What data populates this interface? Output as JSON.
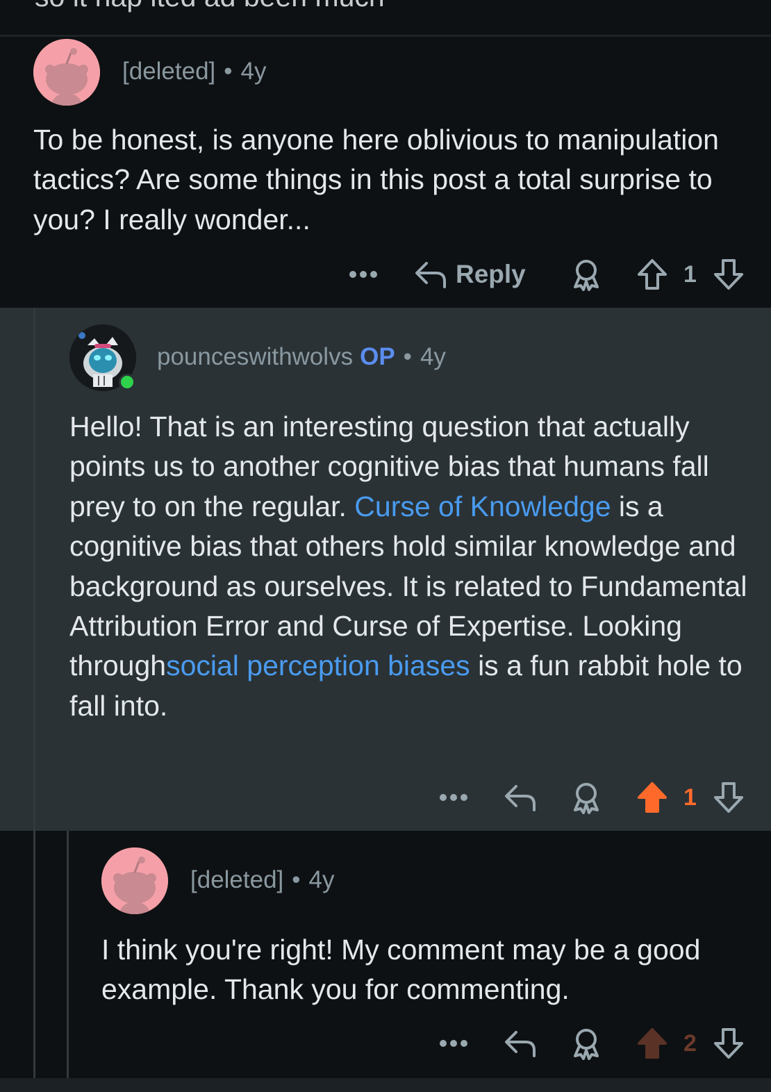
{
  "previous_text_fragment": "so it hap ited ad been much",
  "comments": [
    {
      "user": "[deleted]",
      "separator": "•",
      "age": "4y",
      "body": "To be honest, is anyone here oblivious to manipulation tactics? Are some things in this post a total surprise to you? I really wonder...",
      "reply_label": "Reply",
      "score": "1",
      "vote_state": "none"
    },
    {
      "user": "pounceswithwolvs",
      "op_badge": "OP",
      "separator": "•",
      "age": "4y",
      "body_parts": {
        "p1": "Hello! That is an interesting question that actually points us to another cognitive bias that humans fall prey to on the regular.",
        "link1": "Curse of Knowledge",
        "p2": "is a cognitive bias that others hold similar knowledge and background as ourselves. It is related to Fundamental Attribution Error and Curse of Expertise. Looking through",
        "link2": "social perception biases",
        "p3": "is a fun rabbit hole to fall into."
      },
      "score": "1",
      "vote_state": "upvoted"
    },
    {
      "user": "[deleted]",
      "separator": "•",
      "age": "4y",
      "body": "I think you're right! My comment may be a good example. Thank you for commenting.",
      "score": "2",
      "vote_state": "upvoted-dim"
    }
  ],
  "icons": {
    "more": "more-icon",
    "reply": "reply-icon",
    "award": "award-icon",
    "upvote": "upvote-icon",
    "downvote": "downvote-icon"
  },
  "colors": {
    "background": "#0e1113",
    "highlight_background": "#2a3236",
    "link": "#4a9bef",
    "op": "#5b8def",
    "upvote_active": "#ff6a2b",
    "upvote_dim": "#5a3226"
  }
}
